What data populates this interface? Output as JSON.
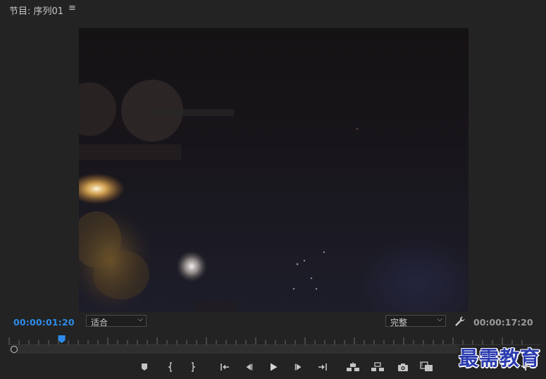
{
  "panel": {
    "title": "节目: 序列01",
    "menu_icon": "hamburger-menu-icon"
  },
  "playback": {
    "current_timecode": "00:00:01:20",
    "duration_timecode": "00:00:17:20",
    "zoom_select": {
      "value": "适合"
    },
    "quality_select": {
      "value": "完整"
    },
    "playhead_position_fraction": 0.1
  },
  "transport": {
    "buttons": [
      "add-marker-icon",
      "mark-in-icon",
      "mark-out-icon",
      "go-to-in-icon",
      "step-back-icon",
      "play-icon",
      "step-forward-icon",
      "go-to-out-icon",
      "lift-icon",
      "extract-icon",
      "export-frame-icon",
      "comparison-view-icon"
    ]
  },
  "watermark": {
    "text": "最需教育"
  },
  "colors": {
    "accent_blue": "#2d8ceb",
    "panel_bg": "#232323",
    "watermark_blue": "#2a3bb0"
  }
}
